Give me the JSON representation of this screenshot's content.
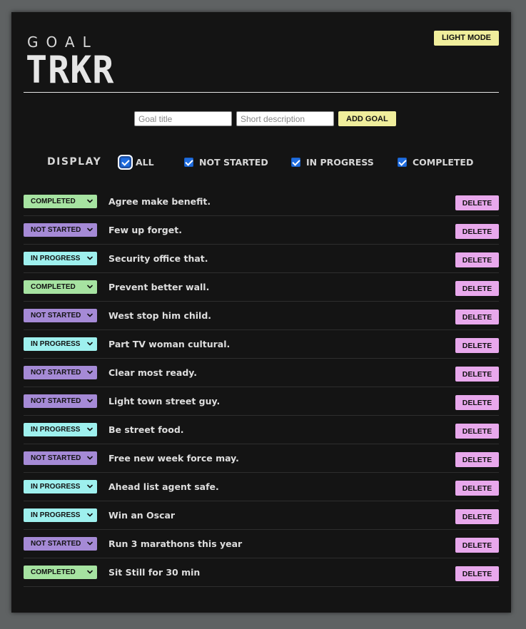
{
  "app": {
    "logo_top": "GOAL",
    "logo_bottom": "TRKR",
    "mode_button": "LIGHT MODE"
  },
  "add_form": {
    "title_placeholder": "Goal title",
    "description_placeholder": "Short description",
    "add_button": "ADD GOAL"
  },
  "filters": {
    "label": "DISPLAY",
    "options": [
      {
        "label": "ALL",
        "checked": true
      },
      {
        "label": "NOT STARTED",
        "checked": true
      },
      {
        "label": "IN PROGRESS",
        "checked": true
      },
      {
        "label": "COMPLETED",
        "checked": true
      }
    ]
  },
  "status_colors": {
    "COMPLETED": "#a6e3a1",
    "NOT STARTED": "#a58ad6",
    "IN PROGRESS": "#9ef0ee"
  },
  "delete_label": "DELETE",
  "goals": [
    {
      "status": "COMPLETED",
      "title": "Agree make benefit."
    },
    {
      "status": "NOT STARTED",
      "title": "Few up forget."
    },
    {
      "status": "IN PROGRESS",
      "title": "Security office that."
    },
    {
      "status": "COMPLETED",
      "title": "Prevent better wall."
    },
    {
      "status": "NOT STARTED",
      "title": "West stop him child."
    },
    {
      "status": "IN PROGRESS",
      "title": "Part TV woman cultural."
    },
    {
      "status": "NOT STARTED",
      "title": "Clear most ready."
    },
    {
      "status": "NOT STARTED",
      "title": "Light town street guy."
    },
    {
      "status": "IN PROGRESS",
      "title": "Be street food."
    },
    {
      "status": "NOT STARTED",
      "title": "Free new week force may."
    },
    {
      "status": "IN PROGRESS",
      "title": "Ahead list agent safe."
    },
    {
      "status": "IN PROGRESS",
      "title": "Win an Oscar"
    },
    {
      "status": "NOT STARTED",
      "title": "Run 3 marathons this year"
    },
    {
      "status": "COMPLETED",
      "title": "Sit Still for 30 min"
    }
  ]
}
